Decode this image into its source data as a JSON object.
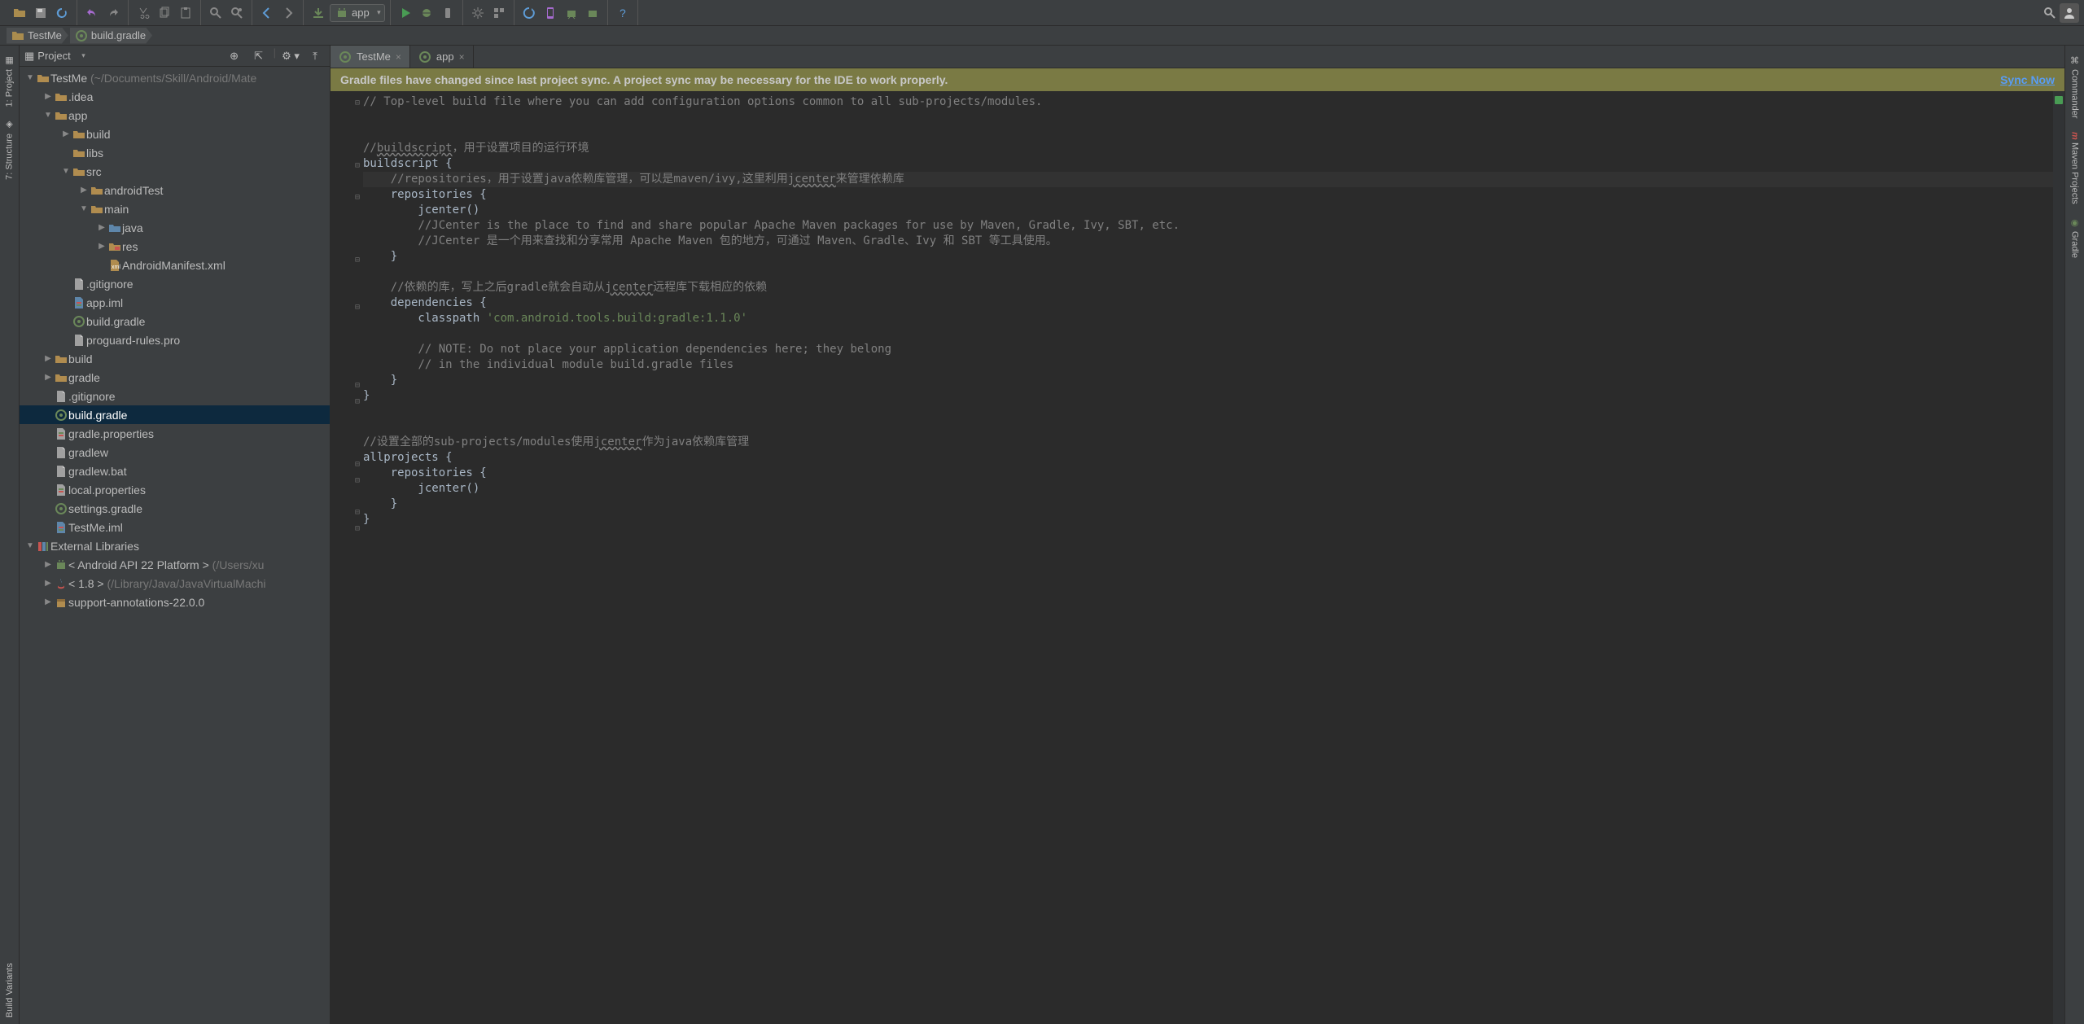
{
  "toolbar": {
    "run_config": "app"
  },
  "breadcrumb": {
    "items": [
      {
        "icon": "folder",
        "label": "TestMe"
      },
      {
        "icon": "gradle",
        "label": "build.gradle"
      }
    ]
  },
  "left_tabs": {
    "project": "1: Project",
    "structure": "7: Structure",
    "build_variants": "Build Variants"
  },
  "right_tabs": {
    "commander": "Commander",
    "maven": "Maven Projects",
    "gradle": "Gradle"
  },
  "project_panel": {
    "view_mode": "Project",
    "tree": [
      {
        "d": 0,
        "arrow": "▼",
        "icon": "folder",
        "label": "TestMe",
        "suffix": " (~/Documents/Skill/Android/Mate"
      },
      {
        "d": 1,
        "arrow": "▶",
        "icon": "folder",
        "label": ".idea"
      },
      {
        "d": 1,
        "arrow": "▼",
        "icon": "folder",
        "label": "app"
      },
      {
        "d": 2,
        "arrow": "▶",
        "icon": "folder",
        "label": "build"
      },
      {
        "d": 2,
        "arrow": "",
        "icon": "folder",
        "label": "libs"
      },
      {
        "d": 2,
        "arrow": "▼",
        "icon": "folder",
        "label": "src"
      },
      {
        "d": 3,
        "arrow": "▶",
        "icon": "folder",
        "label": "androidTest"
      },
      {
        "d": 3,
        "arrow": "▼",
        "icon": "folder",
        "label": "main"
      },
      {
        "d": 4,
        "arrow": "▶",
        "icon": "folder-blue",
        "label": "java"
      },
      {
        "d": 4,
        "arrow": "▶",
        "icon": "folder-res",
        "label": "res"
      },
      {
        "d": 4,
        "arrow": "",
        "icon": "xml",
        "label": "AndroidManifest.xml"
      },
      {
        "d": 2,
        "arrow": "",
        "icon": "file",
        "label": ".gitignore"
      },
      {
        "d": 2,
        "arrow": "",
        "icon": "iml",
        "label": "app.iml"
      },
      {
        "d": 2,
        "arrow": "",
        "icon": "gradle",
        "label": "build.gradle"
      },
      {
        "d": 2,
        "arrow": "",
        "icon": "file",
        "label": "proguard-rules.pro"
      },
      {
        "d": 1,
        "arrow": "▶",
        "icon": "folder",
        "label": "build"
      },
      {
        "d": 1,
        "arrow": "▶",
        "icon": "folder",
        "label": "gradle"
      },
      {
        "d": 1,
        "arrow": "",
        "icon": "file",
        "label": ".gitignore"
      },
      {
        "d": 1,
        "arrow": "",
        "icon": "gradle",
        "label": "build.gradle",
        "selected": true
      },
      {
        "d": 1,
        "arrow": "",
        "icon": "props",
        "label": "gradle.properties"
      },
      {
        "d": 1,
        "arrow": "",
        "icon": "file",
        "label": "gradlew"
      },
      {
        "d": 1,
        "arrow": "",
        "icon": "file",
        "label": "gradlew.bat"
      },
      {
        "d": 1,
        "arrow": "",
        "icon": "props",
        "label": "local.properties"
      },
      {
        "d": 1,
        "arrow": "",
        "icon": "gradle",
        "label": "settings.gradle"
      },
      {
        "d": 1,
        "arrow": "",
        "icon": "iml",
        "label": "TestMe.iml"
      },
      {
        "d": 0,
        "arrow": "▼",
        "icon": "lib",
        "label": "External Libraries"
      },
      {
        "d": 1,
        "arrow": "▶",
        "icon": "android",
        "label": "< Android API 22 Platform >",
        "suffix": " (/Users/xu"
      },
      {
        "d": 1,
        "arrow": "▶",
        "icon": "java",
        "label": "< 1.8 >",
        "suffix": " (/Library/Java/JavaVirtualMachi"
      },
      {
        "d": 1,
        "arrow": "▶",
        "icon": "jar",
        "label": "support-annotations-22.0.0"
      }
    ]
  },
  "editor": {
    "tabs": [
      {
        "icon": "gradle",
        "label": "TestMe",
        "active": true
      },
      {
        "icon": "gradle",
        "label": "app",
        "active": false
      }
    ],
    "notification": {
      "message": "Gradle files have changed since last project sync. A project sync may be necessary for the IDE to work properly.",
      "action": "Sync Now"
    },
    "code_lines": [
      {
        "gutter": "⊟",
        "html": "<span class='comment'>// Top-level build file where you can add configuration options common to all sub-projects/modules.</span>"
      },
      {
        "gutter": "",
        "html": ""
      },
      {
        "gutter": "",
        "html": ""
      },
      {
        "gutter": "",
        "html": "<span class='comment'>//<span class='underline-wavy'>buildscript</span>，用于设置项目的运行环境</span>"
      },
      {
        "gutter": "⊟",
        "html": "buildscript {"
      },
      {
        "gutter": "",
        "html": "<span class='highlight-line'>    <span class='comment'>//repositories，用于设置java依赖库管理，可以是maven/ivy,这里利用<span class='underline-wavy'>jcenter</span>来管理依赖库</span></span>"
      },
      {
        "gutter": "⊟",
        "html": "    repositories {"
      },
      {
        "gutter": "",
        "html": "        jcenter()"
      },
      {
        "gutter": "",
        "html": "        <span class='comment'>//JCenter is the place to find and share popular Apache Maven packages for use by Maven, Gradle, Ivy, SBT, etc.</span>"
      },
      {
        "gutter": "",
        "html": "        <span class='comment'>//JCenter 是一个用来查找和分享常用 Apache Maven 包的地方，可通过 Maven、Gradle、Ivy 和 SBT 等工具使用。</span>"
      },
      {
        "gutter": "⊟",
        "html": "    }"
      },
      {
        "gutter": "",
        "html": ""
      },
      {
        "gutter": "",
        "html": "    <span class='comment'>//依赖的库，写上之后gradle就会自动从<span class='underline-wavy'>jcenter</span>远程库下载相应的依赖</span>"
      },
      {
        "gutter": "⊟",
        "html": "    dependencies {"
      },
      {
        "gutter": "",
        "html": "        classpath <span class='string'>'com.android.tools.build:gradle:1.1.0'</span>"
      },
      {
        "gutter": "",
        "html": ""
      },
      {
        "gutter": "",
        "html": "        <span class='comment'>// NOTE: Do not place your application dependencies here; they belong</span>"
      },
      {
        "gutter": "",
        "html": "        <span class='comment'>// in the individual module build.gradle files</span>"
      },
      {
        "gutter": "⊟",
        "html": "    }"
      },
      {
        "gutter": "⊟",
        "html": "}"
      },
      {
        "gutter": "",
        "html": ""
      },
      {
        "gutter": "",
        "html": ""
      },
      {
        "gutter": "",
        "html": "<span class='comment'>//设置全部的sub-projects/modules使用<span class='underline-wavy'>jcenter</span>作为java依赖库管理</span>"
      },
      {
        "gutter": "⊟",
        "html": "allprojects {"
      },
      {
        "gutter": "⊟",
        "html": "    repositories {"
      },
      {
        "gutter": "",
        "html": "        jcenter()"
      },
      {
        "gutter": "⊟",
        "html": "    }"
      },
      {
        "gutter": "⊟",
        "html": "}"
      }
    ]
  }
}
